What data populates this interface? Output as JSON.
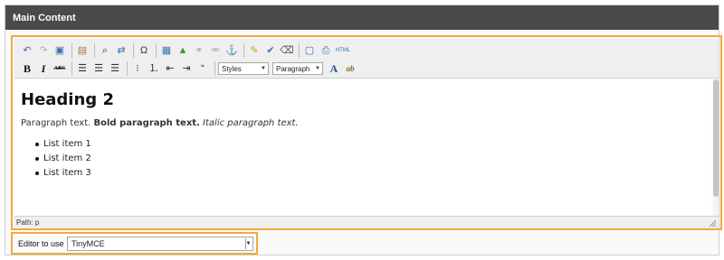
{
  "panel": {
    "title": "Main Content"
  },
  "toolbar": {
    "row1": [
      {
        "name": "undo-icon",
        "glyph": "↶",
        "color": "#3a6fb5"
      },
      {
        "name": "redo-icon",
        "glyph": "↷",
        "color": "#b0b0b0"
      },
      {
        "name": "select-all-icon",
        "glyph": "▣",
        "color": "#3a6fb5"
      },
      {
        "sep": true
      },
      {
        "name": "paste-icon",
        "glyph": "▤",
        "color": "#b07a2a"
      },
      {
        "sep": true
      },
      {
        "name": "find-icon",
        "glyph": "⌕",
        "color": "#333333"
      },
      {
        "name": "replace-icon",
        "glyph": "⇄",
        "color": "#3a6fb5"
      },
      {
        "sep": true
      },
      {
        "name": "special-char-icon",
        "glyph": "Ω",
        "color": "#333333"
      },
      {
        "sep": true
      },
      {
        "name": "template-icon",
        "glyph": "▦",
        "color": "#3a6fb5"
      },
      {
        "name": "insert-image-icon",
        "glyph": "▲",
        "color": "#3a9a3a"
      },
      {
        "name": "link-icon",
        "glyph": "⚭",
        "color": "#b0b0b0"
      },
      {
        "name": "unlink-icon",
        "glyph": "⚮",
        "color": "#b0b0b0"
      },
      {
        "name": "anchor-icon",
        "glyph": "⚓",
        "color": "#2a4f8a"
      },
      {
        "sep": true
      },
      {
        "name": "cleanup-icon",
        "glyph": "✎",
        "color": "#c9a227"
      },
      {
        "name": "spellcheck-icon",
        "glyph": "✔",
        "color": "#3a6fb5"
      },
      {
        "name": "eraser-icon",
        "glyph": "⌫",
        "color": "#555555"
      },
      {
        "sep": true
      },
      {
        "name": "fullscreen-icon",
        "glyph": "▢",
        "color": "#3a6fb5"
      },
      {
        "name": "print-icon",
        "glyph": "⎙",
        "color": "#3a6fb5"
      },
      {
        "name": "html-source-icon",
        "glyph": "HTML",
        "color": "#3a6fb5"
      }
    ],
    "row2_buttons_a": [
      {
        "name": "bold-icon",
        "label": "B"
      },
      {
        "name": "italic-icon",
        "label": "I"
      },
      {
        "name": "strikethrough-icon",
        "label": "ABC"
      }
    ],
    "row2_buttons_b": [
      {
        "name": "align-left-icon",
        "glyph": "☰"
      },
      {
        "name": "align-center-icon",
        "glyph": "☰"
      },
      {
        "name": "align-right-icon",
        "glyph": "☰"
      }
    ],
    "row2_buttons_c": [
      {
        "name": "bullet-list-icon",
        "glyph": "⁝"
      },
      {
        "name": "numbered-list-icon",
        "glyph": "⒈"
      },
      {
        "name": "outdent-icon",
        "glyph": "⇤"
      },
      {
        "name": "indent-icon",
        "glyph": "⇥"
      },
      {
        "name": "blockquote-icon",
        "glyph": "“"
      }
    ],
    "styles_select": "Styles",
    "format_select": "Paragraph",
    "row2_buttons_d": [
      {
        "name": "font-color-icon",
        "glyph": "A"
      },
      {
        "name": "highlight-icon",
        "glyph": "ab"
      }
    ]
  },
  "content": {
    "heading": "Heading 2",
    "paragraph_plain": "Paragraph text.",
    "paragraph_bold": "Bold paragraph text.",
    "paragraph_italic": "Italic paragraph text.",
    "list_items": [
      "List item 1",
      "List item 2",
      "List item 3"
    ]
  },
  "statusbar": {
    "path": "Path: p"
  },
  "editor_select": {
    "label": "Editor to use",
    "value": "TinyMCE"
  }
}
